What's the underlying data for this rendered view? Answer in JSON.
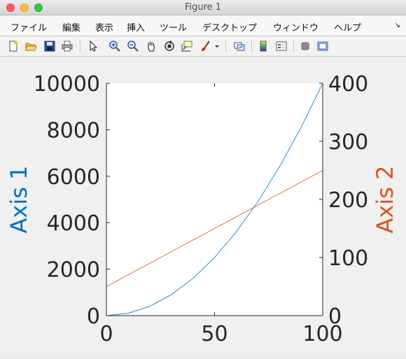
{
  "window": {
    "title": "Figure 1"
  },
  "menu": {
    "items": [
      "ファイル",
      "編集",
      "表示",
      "挿入",
      "ツール",
      "デスクトップ",
      "ウィンドウ",
      "ヘルプ"
    ],
    "overflow_icon": "arrow-diagonal-icon"
  },
  "toolbar": {
    "icons": [
      "new-figure-icon",
      "open-icon",
      "save-icon",
      "print-icon",
      "pointer-icon",
      "zoom-in-icon",
      "zoom-out-icon",
      "pan-hand-icon",
      "rotate-3d-icon",
      "data-cursor-icon",
      "brush-icon",
      "dropdown-arrow-icon",
      "link-plot-icon",
      "colorbar-icon",
      "legend-icon",
      "hide-plot-tools-icon",
      "show-plot-tools-icon"
    ]
  },
  "colors": {
    "axis1": "#0072BD",
    "axis2": "#D95319",
    "text": "#262626"
  },
  "chart_data": {
    "type": "line",
    "x_range": [
      0,
      100
    ],
    "x_ticks": [
      "0",
      "50",
      "100"
    ],
    "left_axis": {
      "label": "Axis 1",
      "ylim": [
        0,
        10000
      ],
      "ticks": [
        "0",
        "2000",
        "4000",
        "6000",
        "8000",
        "10000"
      ]
    },
    "right_axis": {
      "label": "Axis 2",
      "ylim": [
        0,
        400
      ],
      "ticks": [
        "0",
        "100",
        "200",
        "300",
        "400"
      ]
    },
    "series": [
      {
        "axis": "left",
        "color": "#0072BD",
        "x": [
          0,
          10,
          20,
          30,
          40,
          50,
          60,
          70,
          80,
          90,
          100
        ],
        "y": [
          0,
          100,
          400,
          900,
          1600,
          2500,
          3600,
          4900,
          6400,
          8100,
          10000
        ]
      },
      {
        "axis": "right",
        "color": "#D95319",
        "x": [
          0,
          50,
          100
        ],
        "y": [
          50,
          150,
          250
        ]
      }
    ]
  }
}
